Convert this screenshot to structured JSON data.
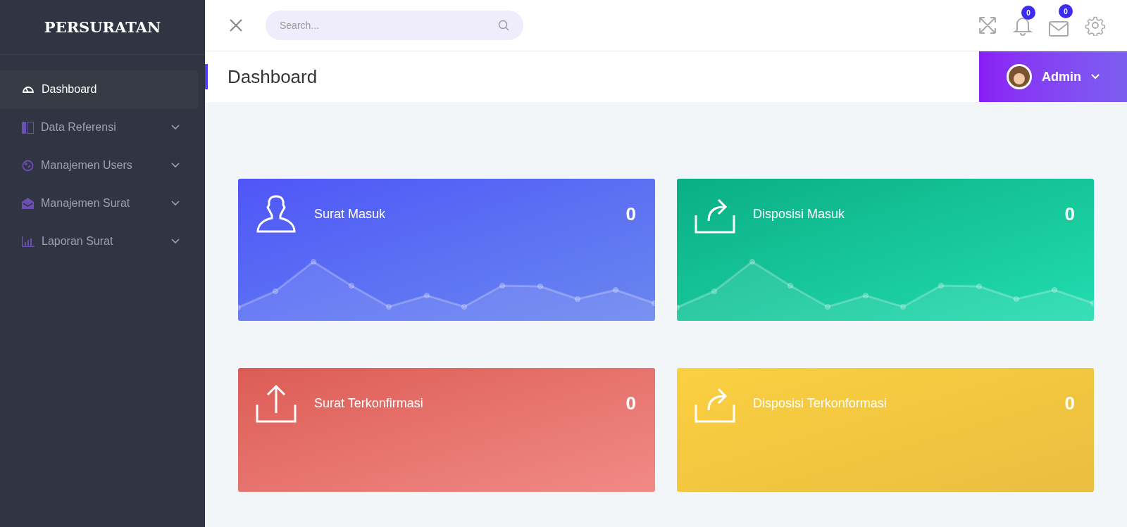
{
  "brand": "PERSURATAN",
  "sidebar": {
    "items": [
      {
        "label": "Dashboard",
        "kind": "gauge",
        "selected": true,
        "has_submenu": false
      },
      {
        "label": "Data Referensi",
        "kind": "columns",
        "selected": false,
        "has_submenu": true
      },
      {
        "label": "Manajemen Users",
        "kind": "palette",
        "selected": false,
        "has_submenu": true
      },
      {
        "label": "Manajemen Surat",
        "kind": "envelope",
        "selected": false,
        "has_submenu": true
      },
      {
        "label": "Laporan Surat",
        "kind": "bars",
        "selected": false,
        "has_submenu": true
      }
    ]
  },
  "topbar": {
    "search": {
      "placeholder": "Search..."
    },
    "notifications": "0",
    "messages": "0"
  },
  "header": {
    "title": "Dashboard",
    "user": "Admin"
  },
  "cards": [
    {
      "label": "Surat Masuk",
      "value": "0",
      "kind": "user",
      "sparkline": true
    },
    {
      "label": "Disposisi Masuk",
      "value": "0",
      "kind": "share",
      "sparkline": true
    },
    {
      "label": "Surat Terkonfirmasi",
      "value": "0",
      "kind": "upload",
      "sparkline": false
    },
    {
      "label": "Disposisi Terkonformasi",
      "value": "0",
      "kind": "share",
      "sparkline": false
    }
  ]
}
